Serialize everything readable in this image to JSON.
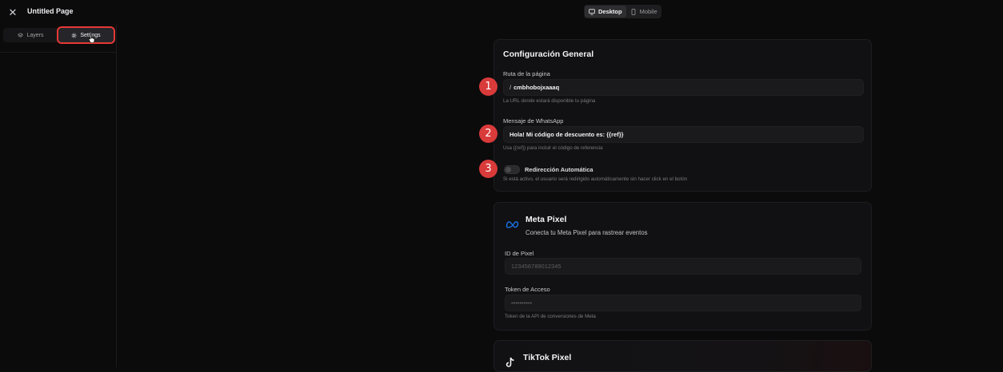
{
  "header": {
    "title": "Untitled Page",
    "device_toggle": [
      {
        "label": "Desktop",
        "active": true,
        "icon": "monitor-icon"
      },
      {
        "label": "Mobile",
        "active": false,
        "icon": "smartphone-icon"
      }
    ]
  },
  "left_panel": {
    "tabs": [
      {
        "label": "Layers",
        "icon": "layers-icon",
        "active": false
      },
      {
        "label": "Settings",
        "icon": "gear-icon",
        "active": true
      }
    ]
  },
  "general": {
    "title": "Configuración General",
    "route": {
      "label": "Ruta de la página",
      "prefix": "/",
      "value": "cmbhobojxaaaq",
      "help": "La URL donde estará disponible tu página"
    },
    "whatsapp": {
      "label": "Mensaje de WhatsApp",
      "value": "Hola! Mi código de descuento es: {{ref}}",
      "help": "Usa {{ref}} para incluir el código de referencia"
    },
    "redirect": {
      "label": "Redirección Automática",
      "enabled": false,
      "help": "Si está activo, el usuario será redirigido automáticamente sin hacer click en el botón"
    }
  },
  "annotations": [
    "1",
    "2",
    "3"
  ],
  "meta_pixel": {
    "title": "Meta Pixel",
    "subtitle": "Conecta tu Meta Pixel para rastrear eventos",
    "pixel_id": {
      "label": "ID de Pixel",
      "placeholder": "123456789012345"
    },
    "token": {
      "label": "Token de Acceso",
      "placeholder": "••••••••••",
      "help": "Token de la API de conversiones de Meta"
    }
  },
  "tiktok_pixel": {
    "title": "TikTok Pixel"
  },
  "colors": {
    "background": "#0b0b0c",
    "card": "#111113",
    "accent_red": "#d93a3a",
    "meta_blue": "#1877f2"
  }
}
